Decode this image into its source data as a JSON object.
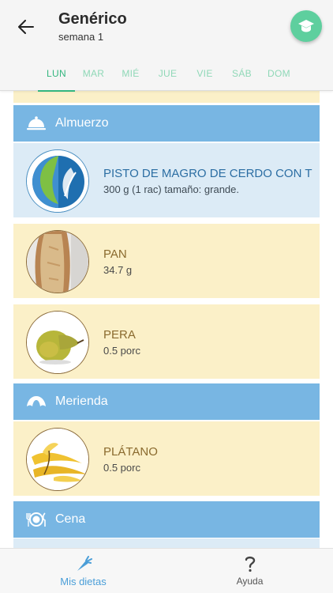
{
  "header": {
    "title": "Genérico",
    "subtitle": "semana 1",
    "back_icon": "arrow-left-icon",
    "fab_icon": "graduation-cap-icon",
    "fab_color": "#5ecf9e"
  },
  "tabs": [
    {
      "label": "LUN",
      "active": true
    },
    {
      "label": "MAR",
      "active": false
    },
    {
      "label": "MIÉ",
      "active": false
    },
    {
      "label": "JUE",
      "active": false
    },
    {
      "label": "VIE",
      "active": false
    },
    {
      "label": "SÁB",
      "active": false
    },
    {
      "label": "DOM",
      "active": false
    }
  ],
  "sections": {
    "almuerzo": {
      "label": "Almuerzo",
      "icon": "cloche-icon",
      "items": [
        {
          "name": "PISTO DE MAGRO DE CERDO CON T",
          "qty": "300 g (1 rac) tamaño: grande.",
          "image": "recipe-logo-icon"
        },
        {
          "name": "PAN",
          "qty": "34.7 g",
          "image": "bread-photo"
        },
        {
          "name": "PERA",
          "qty": "0.5 porc",
          "image": "pear-photo"
        }
      ]
    },
    "merienda": {
      "label": "Merienda",
      "icon": "croissant-icon",
      "items": [
        {
          "name": "PLÁTANO",
          "qty": "0.5 porc",
          "image": "banana-photo"
        }
      ]
    },
    "cena": {
      "label": "Cena",
      "icon": "plate-cutlery-icon"
    }
  },
  "bottom_nav": {
    "dietas": {
      "label": "Mis dietas",
      "icon": "carrot-icon",
      "active": true
    },
    "ayuda": {
      "label": "Ayuda",
      "icon": "question-mark-icon",
      "active": false
    }
  },
  "colors": {
    "accent_green": "#34b67f",
    "section_blue": "#78b6e3",
    "item_yellow": "#fbf0c8",
    "item_blue": "#dcebf6",
    "nav_active_blue": "#4a9ed8"
  }
}
